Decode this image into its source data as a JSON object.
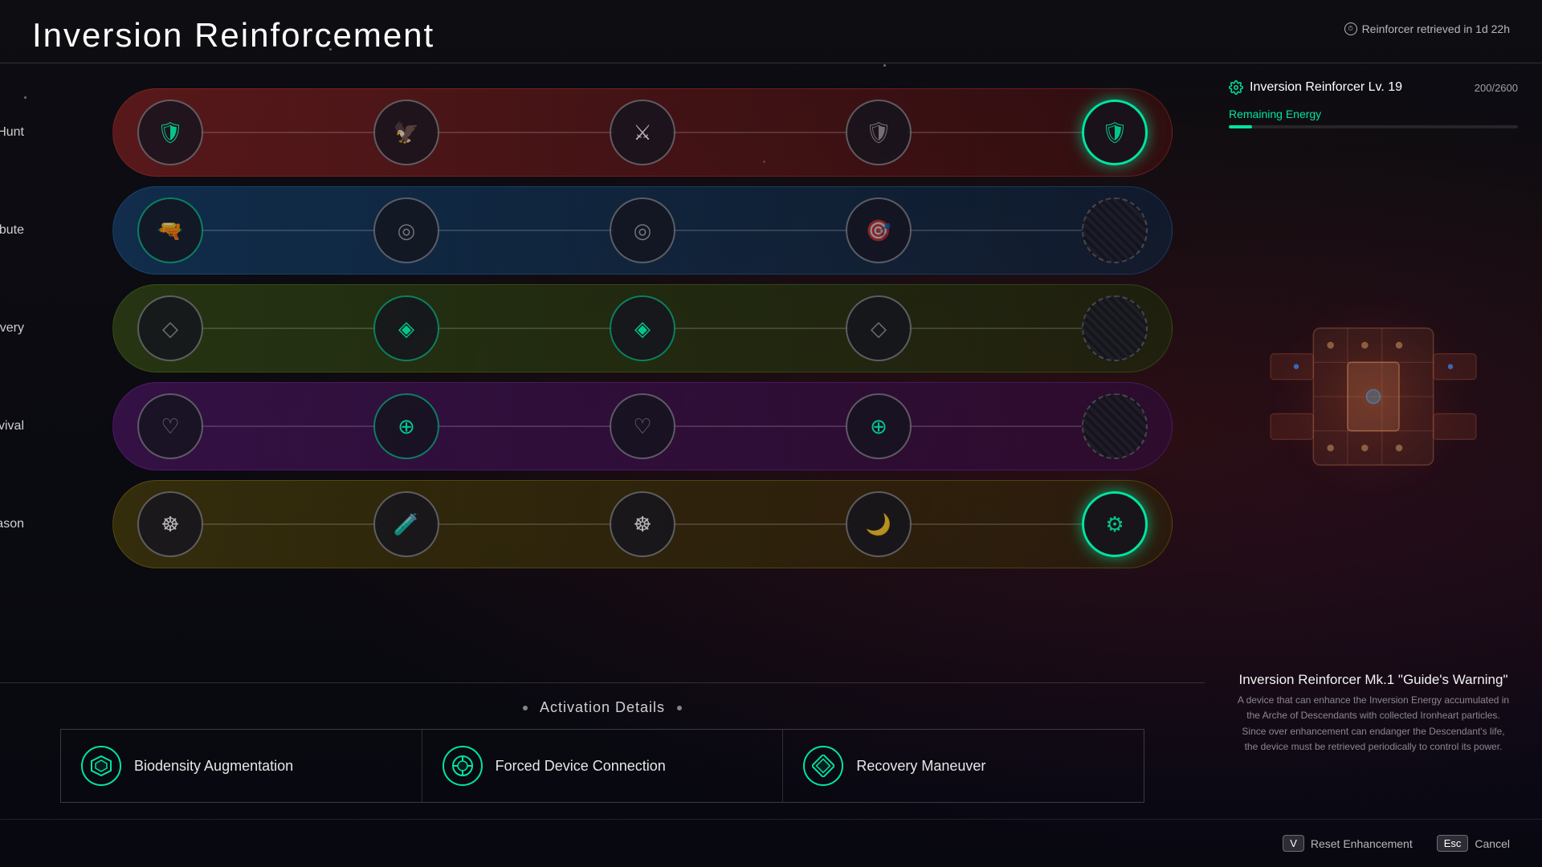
{
  "header": {
    "title": "Inversion Reinforcement",
    "timer_text": "Reinforcer retrieved in 1d 22h"
  },
  "right_panel": {
    "reinforcer_title": "Inversion Reinforcer Lv. 19",
    "reinforcer_xp": "200/2600",
    "energy_label": "Remaining Energy",
    "device_name": "Inversion Reinforcer Mk.1 \"Guide's Warning\"",
    "device_desc": "A device that can enhance the Inversion Energy accumulated in the Arche of Descendants with collected Ironheart particles. Since over enhancement can endanger the Descendant's life, the device must be retrieved periodically to control its power."
  },
  "rows": [
    {
      "id": "hunt",
      "label": "Hunt"
    },
    {
      "id": "attribute",
      "label": "Attribute"
    },
    {
      "id": "recovery",
      "label": "Recovery"
    },
    {
      "id": "survival",
      "label": "Survival"
    },
    {
      "id": "season",
      "label": "Season"
    }
  ],
  "activation": {
    "title": "Activation Details",
    "cards": [
      {
        "id": "biodensity",
        "label": "Biodensity Augmentation",
        "icon": "⬡"
      },
      {
        "id": "forced",
        "label": "Forced Device Connection",
        "icon": "⚙"
      },
      {
        "id": "recovery",
        "label": "Recovery Maneuver",
        "icon": "◇"
      }
    ]
  },
  "bottom_actions": [
    {
      "id": "reset",
      "key": "V",
      "label": "Reset Enhancement"
    },
    {
      "id": "cancel",
      "key": "Esc",
      "label": "Cancel"
    }
  ]
}
